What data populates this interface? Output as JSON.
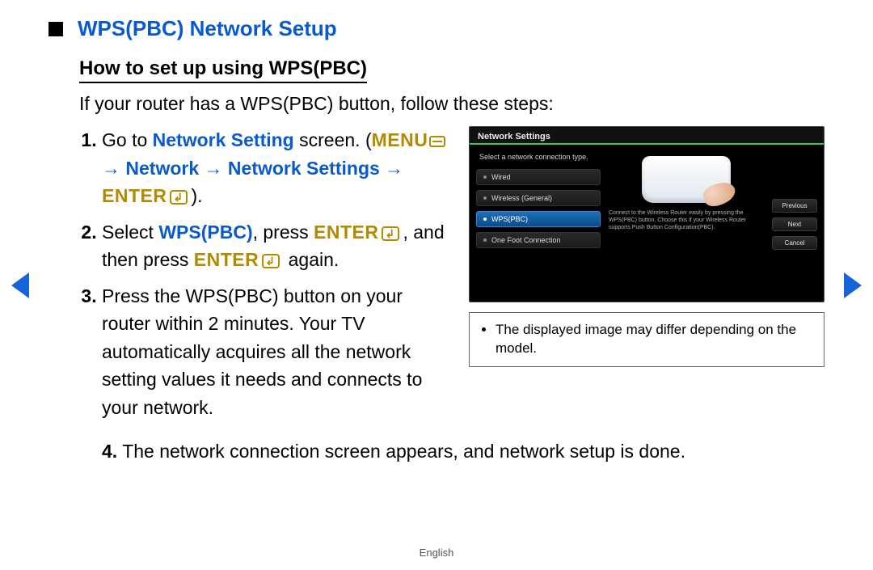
{
  "header": {
    "title": "WPS(PBC) Network Setup"
  },
  "sub_heading": "How to set up using WPS(PBC)",
  "intro": "If your router has a WPS(PBC) button, follow these steps:",
  "steps": {
    "s1_a": "Go to ",
    "s1_link": "Network Setting",
    "s1_b": " screen. (",
    "s1_menu": "MENU",
    "s1_arrow1": " → ",
    "s1_net1": "Network",
    "s1_arrow2": " → ",
    "s1_net2": "Network Settings",
    "s1_arrow3": " → ",
    "s1_enter": "ENTER",
    "s1_c": ").",
    "s2_a": "Select ",
    "s2_wps": "WPS(PBC)",
    "s2_b": ", press ",
    "s2_enter1": "ENTER",
    "s2_c": ", and then press ",
    "s2_enter2": "ENTER",
    "s2_d": " again.",
    "s3": "Press the WPS(PBC) button on your router within 2 minutes. Your TV automatically acquires all the network setting values it needs and connects to your network.",
    "s4": "The network connection screen appears, and network setup is done."
  },
  "tv": {
    "title": "Network Settings",
    "instruction": "Select a network connection type.",
    "options": [
      "Wired",
      "Wireless (General)",
      "WPS(PBC)",
      "One Foot Connection"
    ],
    "desc": "Connect to the Wireless Router easily by pressing the WPS(PBC) button. Choose this if your Wireless Router supports Push Button Configuration(PBC).",
    "buttons": {
      "prev": "Previous",
      "next": "Next",
      "cancel": "Cancel"
    }
  },
  "note": "The displayed image may differ depending on the model.",
  "footer": "English"
}
